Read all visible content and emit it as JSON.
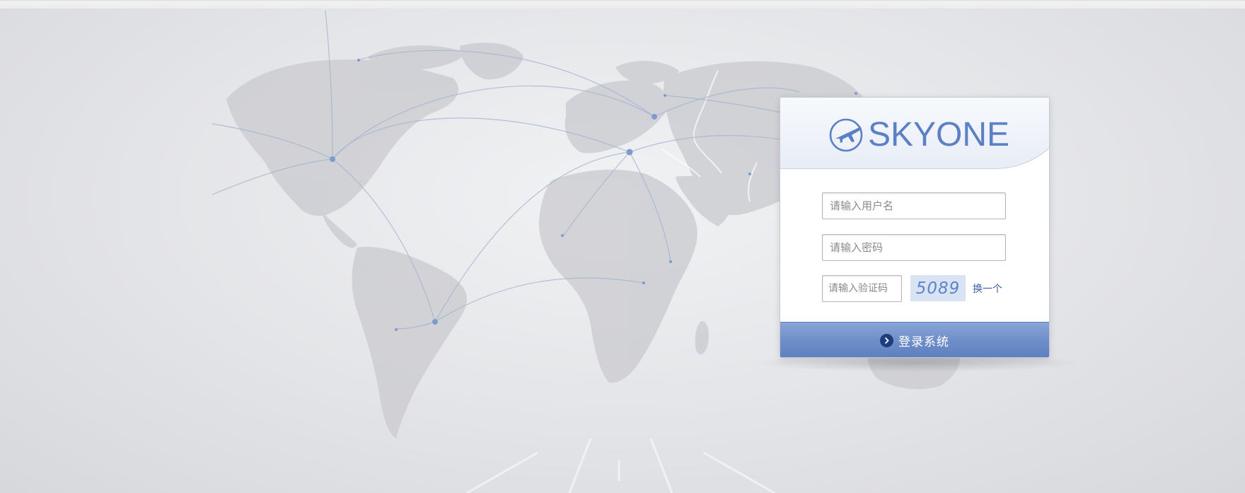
{
  "brand": {
    "name": "SKYONE",
    "icon": "plane-logo-icon",
    "color": "#5b80c4"
  },
  "form": {
    "username_placeholder": "请输入用户名",
    "password_placeholder": "请输入密码",
    "captcha_placeholder": "请输入验证码",
    "captcha_code": "5089",
    "refresh_label": "换一个",
    "submit_label": "登录系统",
    "submit_icon": "chevron-right-icon"
  },
  "colors": {
    "accent": "#6f8fca",
    "link": "#3c5fa6",
    "captcha_bg": "#d9e3f3"
  }
}
